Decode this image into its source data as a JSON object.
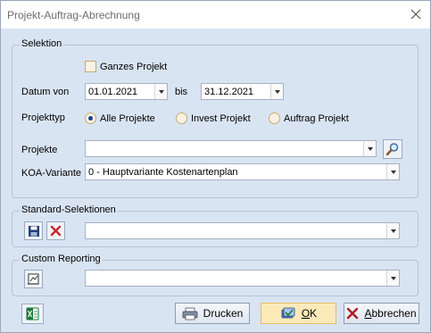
{
  "window": {
    "title": "Projekt-Auftrag-Abrechnung",
    "close_icon": "close-icon"
  },
  "selektion": {
    "title": "Selektion",
    "ganzes_projekt_label": "Ganzes Projekt",
    "ganzes_projekt_checked": false,
    "datum_von_label": "Datum von",
    "datum_von_value": "01.01.2021",
    "bis_label": "bis",
    "datum_bis_value": "31.12.2021",
    "projekttyp_label": "Projekttyp",
    "projekttyp_options": [
      "Alle Projekte",
      "Invest Projekt",
      "Auftrag Projekt"
    ],
    "projekttyp_selected": "Alle Projekte",
    "projekte_label": "Projekte",
    "projekte_value": "",
    "koa_label": "KOA-Variante",
    "koa_value": "0 - Hauptvariante Kostenartenplan"
  },
  "standard": {
    "title": "Standard-Selektionen",
    "value": ""
  },
  "custom": {
    "title": "Custom Reporting",
    "value": ""
  },
  "buttons": {
    "drucken": "Drucken",
    "ok_accel": "O",
    "ok_rest": "K",
    "abbrechen_accel": "A",
    "abbrechen_rest": "bbrechen"
  },
  "colors": {
    "window_bg": "#d9e4f3",
    "ok_button_bg": "#fce9b9",
    "delete_red": "#c8282a",
    "radio_dot": "#1b3f8f"
  }
}
